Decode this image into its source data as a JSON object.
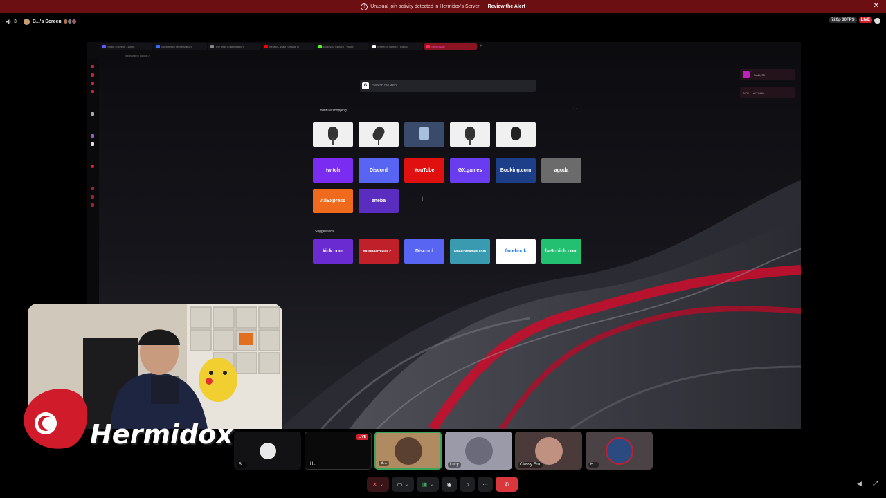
{
  "alert": {
    "icon": "warning-icon",
    "message": "Unusual join activity detected in Hermidox's Server",
    "action": "Review the Alert"
  },
  "call_header": {
    "participant_count": "3",
    "screen_title": "B...'s Screen",
    "quality": "720p 30FPS",
    "live": "LIVE"
  },
  "browser": {
    "tabs": [
      {
        "label": "Stripe Express - Login",
        "color": "#635bff"
      },
      {
        "label": "Sketchfab | Monetization",
        "color": "#3a6cff"
      },
      {
        "label": "The best Chatbot and fr",
        "color": "#888888"
      },
      {
        "label": "Kerato - Walk (Official Vi",
        "color": "#ff0000"
      },
      {
        "label": "Buddy30 Stream - Watch",
        "color": "#53fc18"
      },
      {
        "label": "Wheel of Names | Rando",
        "color": "#ffffff"
      },
      {
        "label": "Speed Dial",
        "color": "#ff2a52",
        "active": true
      }
    ],
    "address": "TrippyAlien/ Blood :(",
    "search_placeholder": "Search the web",
    "widgets": {
      "music": "Buddy35",
      "temp": "26°C",
      "location": "Al Tikidin"
    },
    "continue_label": "Continue shopping",
    "suggestions_label": "Suggestions",
    "speed_dial": [
      {
        "label": "twitch",
        "bg": "#7a2cf0"
      },
      {
        "label": "Discord",
        "bg": "#5865f2"
      },
      {
        "label": "YouTube",
        "bg": "#e01010"
      },
      {
        "label": "GX.games",
        "bg": "#6a3cf0"
      },
      {
        "label": "Booking.com",
        "bg": "#1d3f8a"
      },
      {
        "label": "agoda",
        "bg": "#6b6b6b"
      },
      {
        "label": "AliExpress",
        "bg": "#f06a1e"
      },
      {
        "label": "eneba",
        "bg": "#5a2cc0"
      }
    ],
    "suggestions": [
      {
        "label": "kick.com",
        "bg": "#6a2cd0",
        "fg": "#ffffff"
      },
      {
        "label": "dashboard.kick.c...",
        "bg": "#c0202a",
        "fg": "#ffffff"
      },
      {
        "label": "Discord",
        "bg": "#5865f2",
        "fg": "#ffffff"
      },
      {
        "label": "wheelofnames.com",
        "bg": "#3a9ab0",
        "fg": "#ffffff"
      },
      {
        "label": "facebook",
        "bg": "#ffffff",
        "fg": "#1877f2"
      },
      {
        "label": "ba9chich.com",
        "bg": "#22c070",
        "fg": "#ffffff"
      }
    ]
  },
  "streamer": {
    "brand": "Hermidox"
  },
  "participants": [
    {
      "name": "B...",
      "live": ""
    },
    {
      "name": "H...",
      "live": "LIVE"
    },
    {
      "name": "B...",
      "live": ""
    },
    {
      "name": "Lucy",
      "live": ""
    },
    {
      "name": "Classy Fox",
      "live": ""
    },
    {
      "name": "H...",
      "live": ""
    }
  ],
  "controls": {
    "mute": "mic-muted-icon",
    "camera": "camera-off-icon",
    "share": "screen-share-icon",
    "activity": "gamepad-icon",
    "soundboard": "soundboard-icon",
    "more": "more-icon",
    "end": "end-call-icon"
  }
}
